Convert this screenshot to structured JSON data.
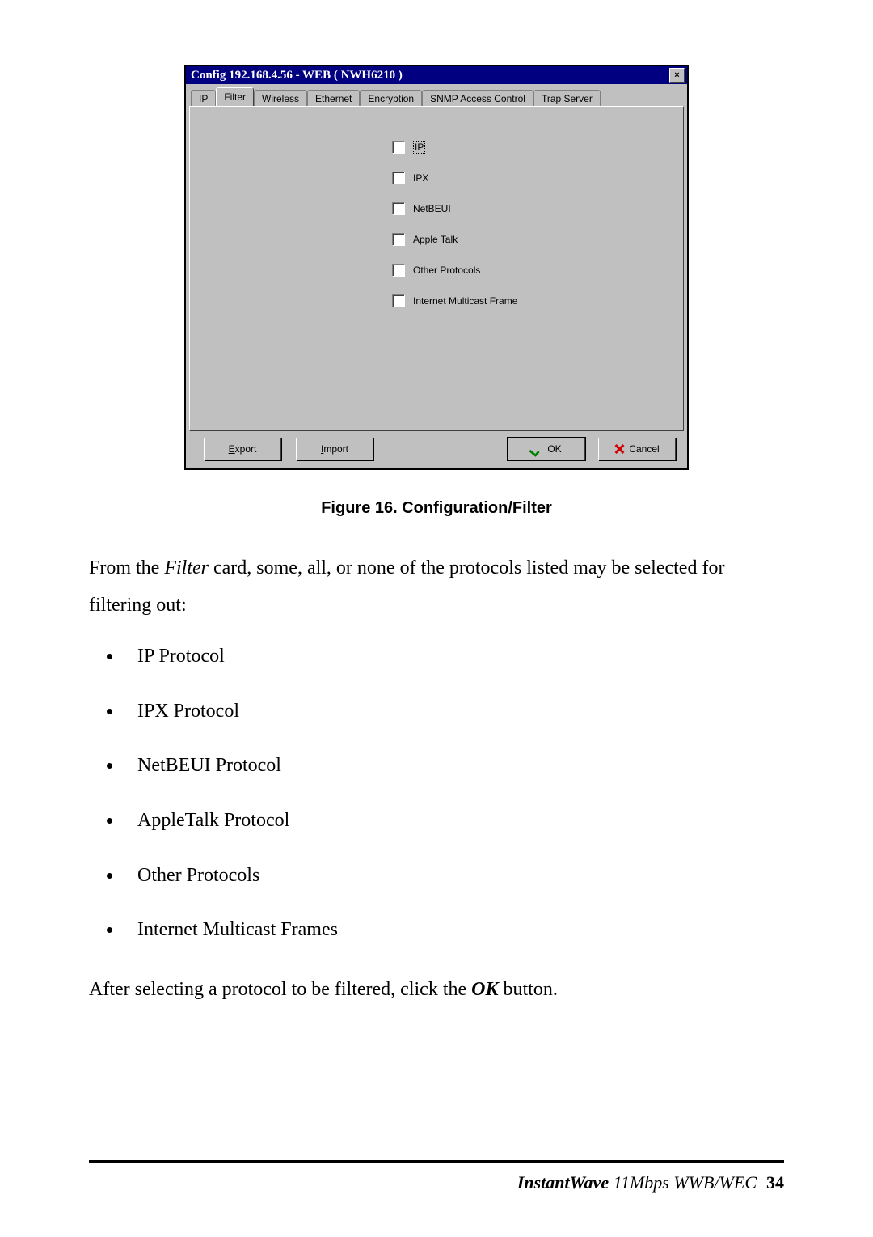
{
  "window": {
    "title": "Config 192.168.4.56 - WEB ( NWH6210 )",
    "close": "×",
    "tabs": [
      "IP",
      "Filter",
      "Wireless",
      "Ethernet",
      "Encryption",
      "SNMP Access Control",
      "Trap Server"
    ],
    "active_tab": "Filter",
    "checks": [
      "IP",
      "IPX",
      "NetBEUI",
      "Apple Talk",
      "Other Protocols",
      "Internet Multicast Frame"
    ],
    "buttons": {
      "export_pre": "E",
      "export_rest": "xport",
      "import_pre": "I",
      "import_rest": "mport",
      "ok": "OK",
      "cancel": "Cancel"
    }
  },
  "caption": "Figure 16.    Configuration/Filter",
  "para1_a": "From the ",
  "para1_i": "Filter",
  "para1_b": " card, some, all, or none of the protocols listed may be selected for filtering out:",
  "protocols": [
    "IP Protocol",
    "IPX Protocol",
    "NetBEUI Protocol",
    "AppleTalk Protocol",
    "Other Protocols",
    "Internet Multicast Frames"
  ],
  "para2_a": "After selecting a protocol to be filtered, click the ",
  "para2_b": "OK",
  "para2_c": " button.",
  "footer": {
    "brand": "InstantWave",
    "model": " 11Mbps WWB/WEC",
    "page": "34"
  }
}
